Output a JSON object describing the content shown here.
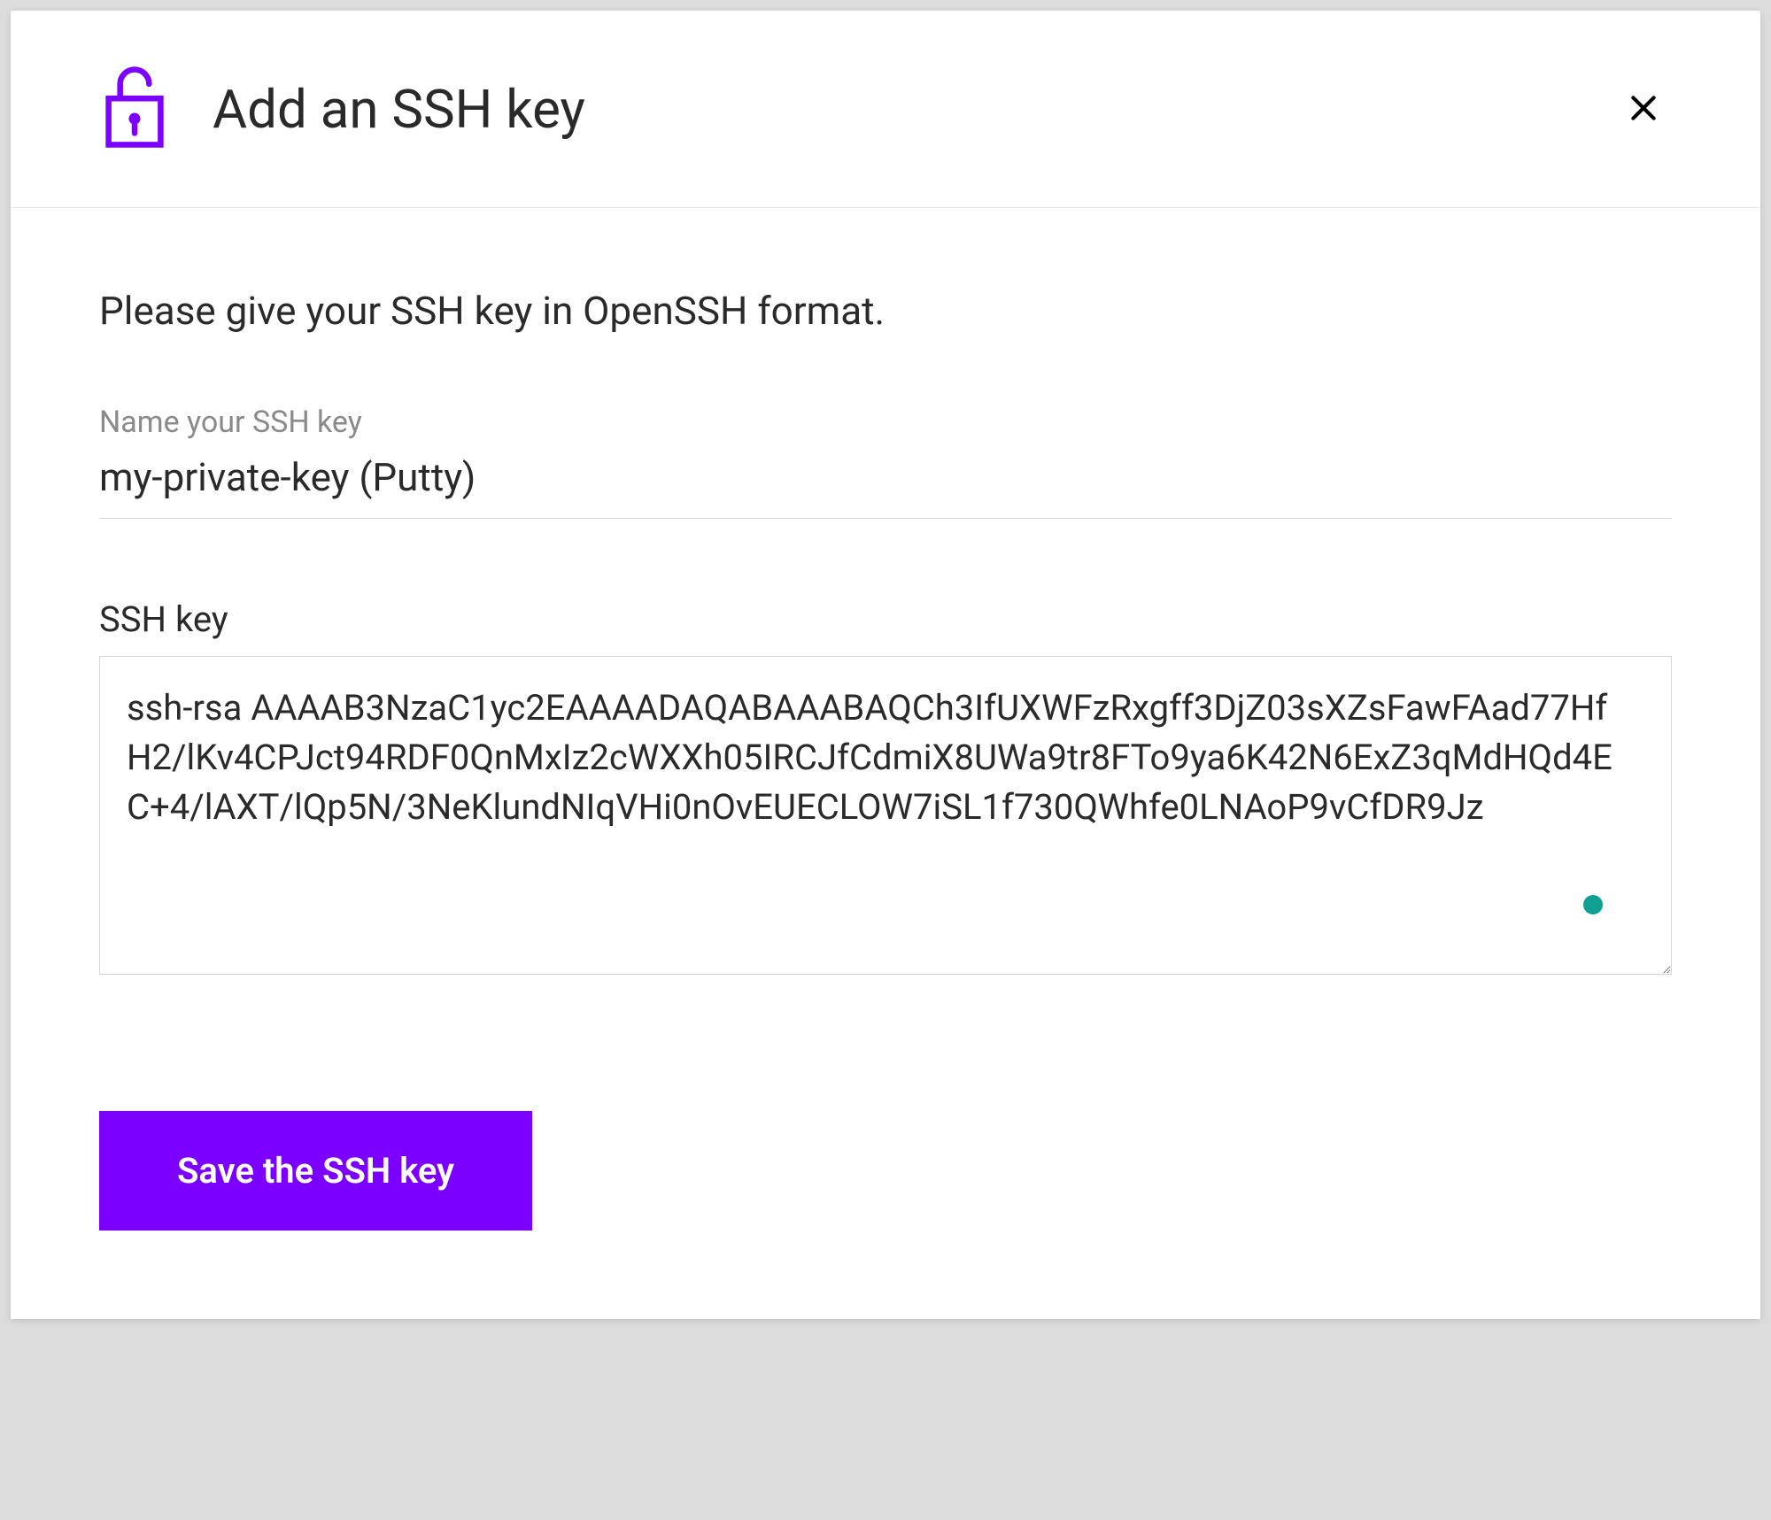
{
  "modal": {
    "title": "Add an SSH key",
    "instruction": "Please give your SSH key in OpenSSH format.",
    "name_field": {
      "label": "Name your SSH key",
      "value": "my-private-key (Putty)"
    },
    "key_field": {
      "label": "SSH key",
      "value": "ssh-rsa AAAAB3NzaC1yc2EAAAADAQABAAABAQCh3IfUXWFzRxgff3DjZ03sXZsFawFAad77HfH2/lKv4CPJct94RDF0QnMxIz2cWXXh05IRCJfCdmiX8UWa9tr8FTo9ya6K42N6ExZ3qMdHQd4EC+4/lAXT/lQp5N/3NeKlundNIqVHi0nOvEUECLOW7iSL1f730QWhfe0LNAoP9vCfDR9Jz"
    },
    "save_button_label": "Save the SSH key"
  },
  "colors": {
    "accent": "#7b00ff"
  }
}
